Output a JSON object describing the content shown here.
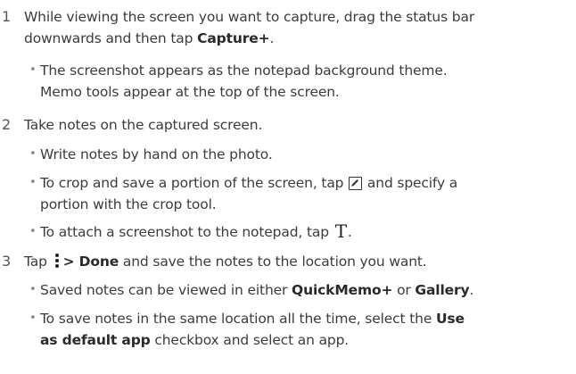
{
  "steps": [
    {
      "number": "1",
      "lines": [
        "While viewing the screen you want to capture, drag the status bar",
        "downwards and then tap ",
        "Capture+",
        "."
      ],
      "bullets": [
        {
          "lines": [
            "The screenshot appears as the notepad background theme.",
            "Memo tools appear at the top of the screen."
          ]
        }
      ]
    },
    {
      "number": "2",
      "text": "Take notes on the captured screen.",
      "bullets": [
        {
          "text": "Write notes by hand on the photo."
        },
        {
          "part1": "To crop and save a portion of the screen, tap ",
          "part2": " and specify a",
          "line2": "portion with the crop tool."
        },
        {
          "part1": "To attach a screenshot to the notepad, tap ",
          "part2": "."
        }
      ]
    },
    {
      "number": "3",
      "part1": "Tap ",
      "bold1": "> Done",
      "part2": " and save the notes to the location you want.",
      "bullets": [
        {
          "part1": "Saved notes can be viewed in either ",
          "bold1": "QuickMemo+",
          "part2": " or ",
          "bold2": "Gallery",
          "part3": "."
        },
        {
          "part1": "To save notes in the same location all the time, select the ",
          "bold1": "Use",
          "bold2": "as default app",
          "part2": " checkbox and select an app."
        }
      ]
    }
  ],
  "bullet_symbol": "•",
  "icons": {
    "crop": "pen-edit-icon",
    "text": "text-tool-icon",
    "more": "more-vertical-icon"
  }
}
